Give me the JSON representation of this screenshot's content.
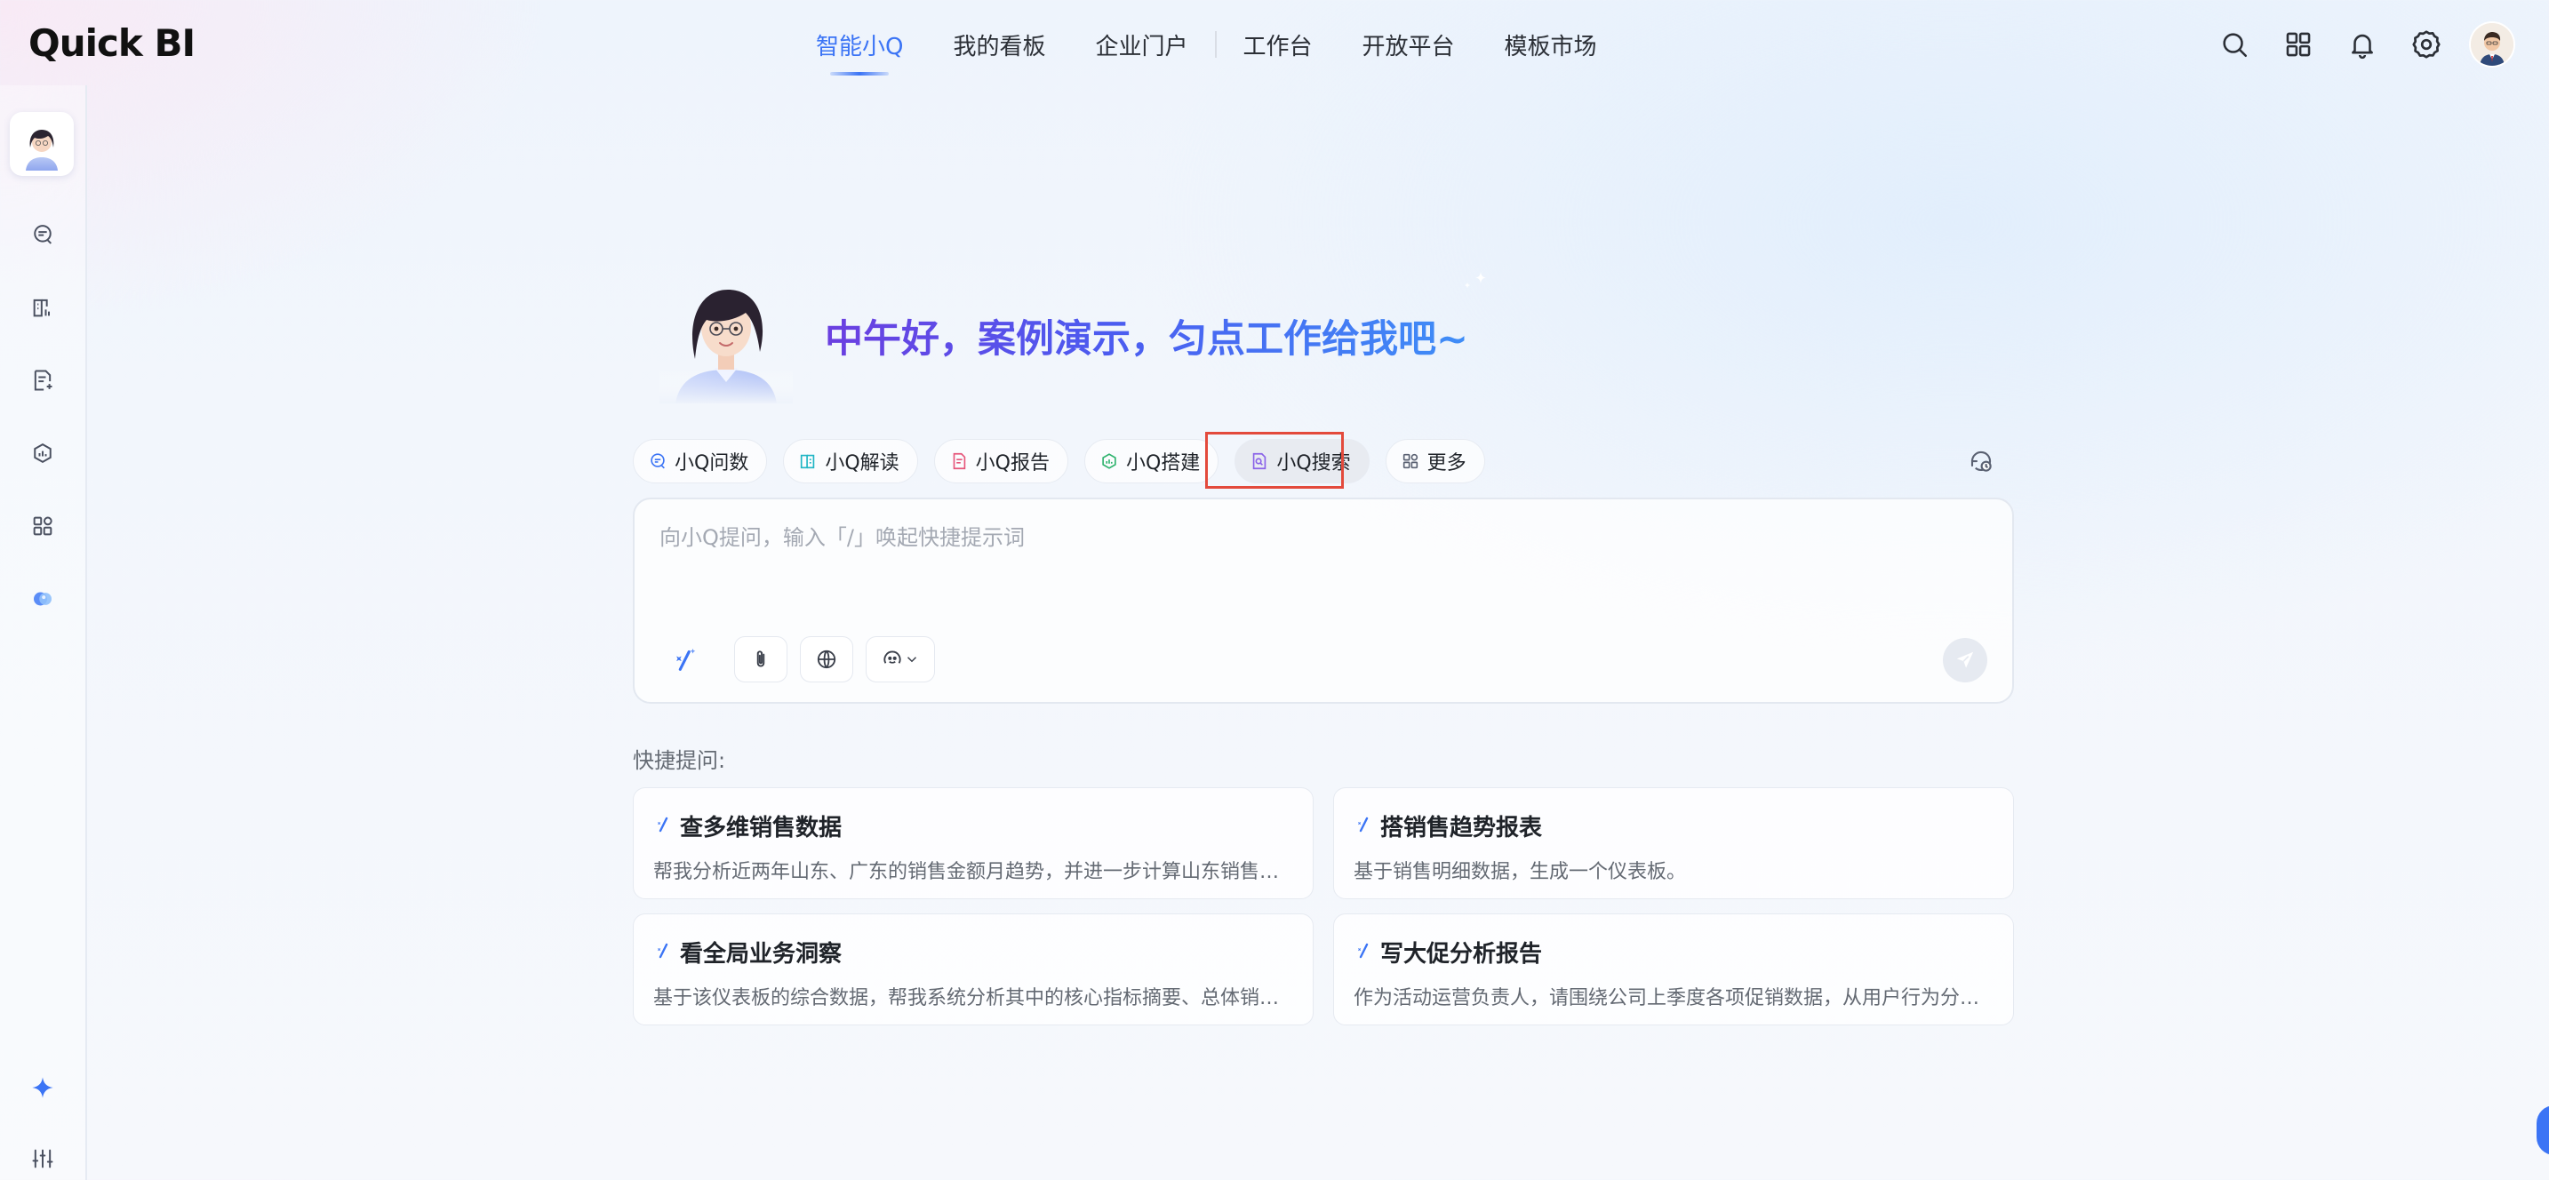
{
  "app": {
    "logo_text": "Quick BI"
  },
  "nav": {
    "items": [
      {
        "label": "智能小Q",
        "active": true
      },
      {
        "label": "我的看板",
        "active": false
      },
      {
        "label": "企业门户",
        "active": false
      },
      {
        "label": "工作台",
        "active": false
      },
      {
        "label": "开放平台",
        "active": false
      },
      {
        "label": "模板市场",
        "active": false
      }
    ]
  },
  "header_icons": [
    "search-icon",
    "apps-grid-icon",
    "bell-icon",
    "settings-icon",
    "user-avatar"
  ],
  "sidebar": {
    "icons": [
      "chat-data-icon",
      "report-book-icon",
      "document-edit-icon",
      "build-chart-icon",
      "apps-icon",
      "ai-model-icon",
      "sparkle-icon",
      "sliders-icon"
    ]
  },
  "hero": {
    "greeting": "中午好，案例演示，匀点工作给我吧~"
  },
  "skills": {
    "chips": [
      {
        "label": "小Q问数",
        "icon": "chat-data-icon"
      },
      {
        "label": "小Q解读",
        "icon": "read-book-icon"
      },
      {
        "label": "小Q报告",
        "icon": "report-doc-icon"
      },
      {
        "label": "小Q搭建",
        "icon": "build-chart-icon"
      },
      {
        "label": "小Q搜索",
        "icon": "search-doc-icon",
        "selected": true
      },
      {
        "label": "更多",
        "icon": "apps-icon"
      }
    ],
    "history_icon": "history-icon"
  },
  "ask": {
    "placeholder": "向小Q提问，输入「/」唤起快捷提示词",
    "value": "",
    "tools": [
      "magic-wand-icon",
      "attachment-icon",
      "globe-icon",
      "model-select-icon",
      "send-icon"
    ]
  },
  "quick": {
    "title": "快捷提问:",
    "cards": [
      {
        "title": "查多维销售数据",
        "desc": "帮我分析近两年山东、广东的销售金额月趋势，并进一步计算山东销售金..."
      },
      {
        "title": "搭销售趋势报表",
        "desc": "基于销售明细数据，生成一个仪表板。"
      },
      {
        "title": "看全局业务洞察",
        "desc": "基于该仪表板的综合数据，帮我系统分析其中的核心指标摘要、总体销售..."
      },
      {
        "title": "写大促分析报告",
        "desc": "作为活动运营负责人，请围绕公司上季度各项促销数据，从用户行为分析..."
      }
    ]
  },
  "colors": {
    "accent": "#3b74f5",
    "highlight_border": "#e34a3c"
  }
}
